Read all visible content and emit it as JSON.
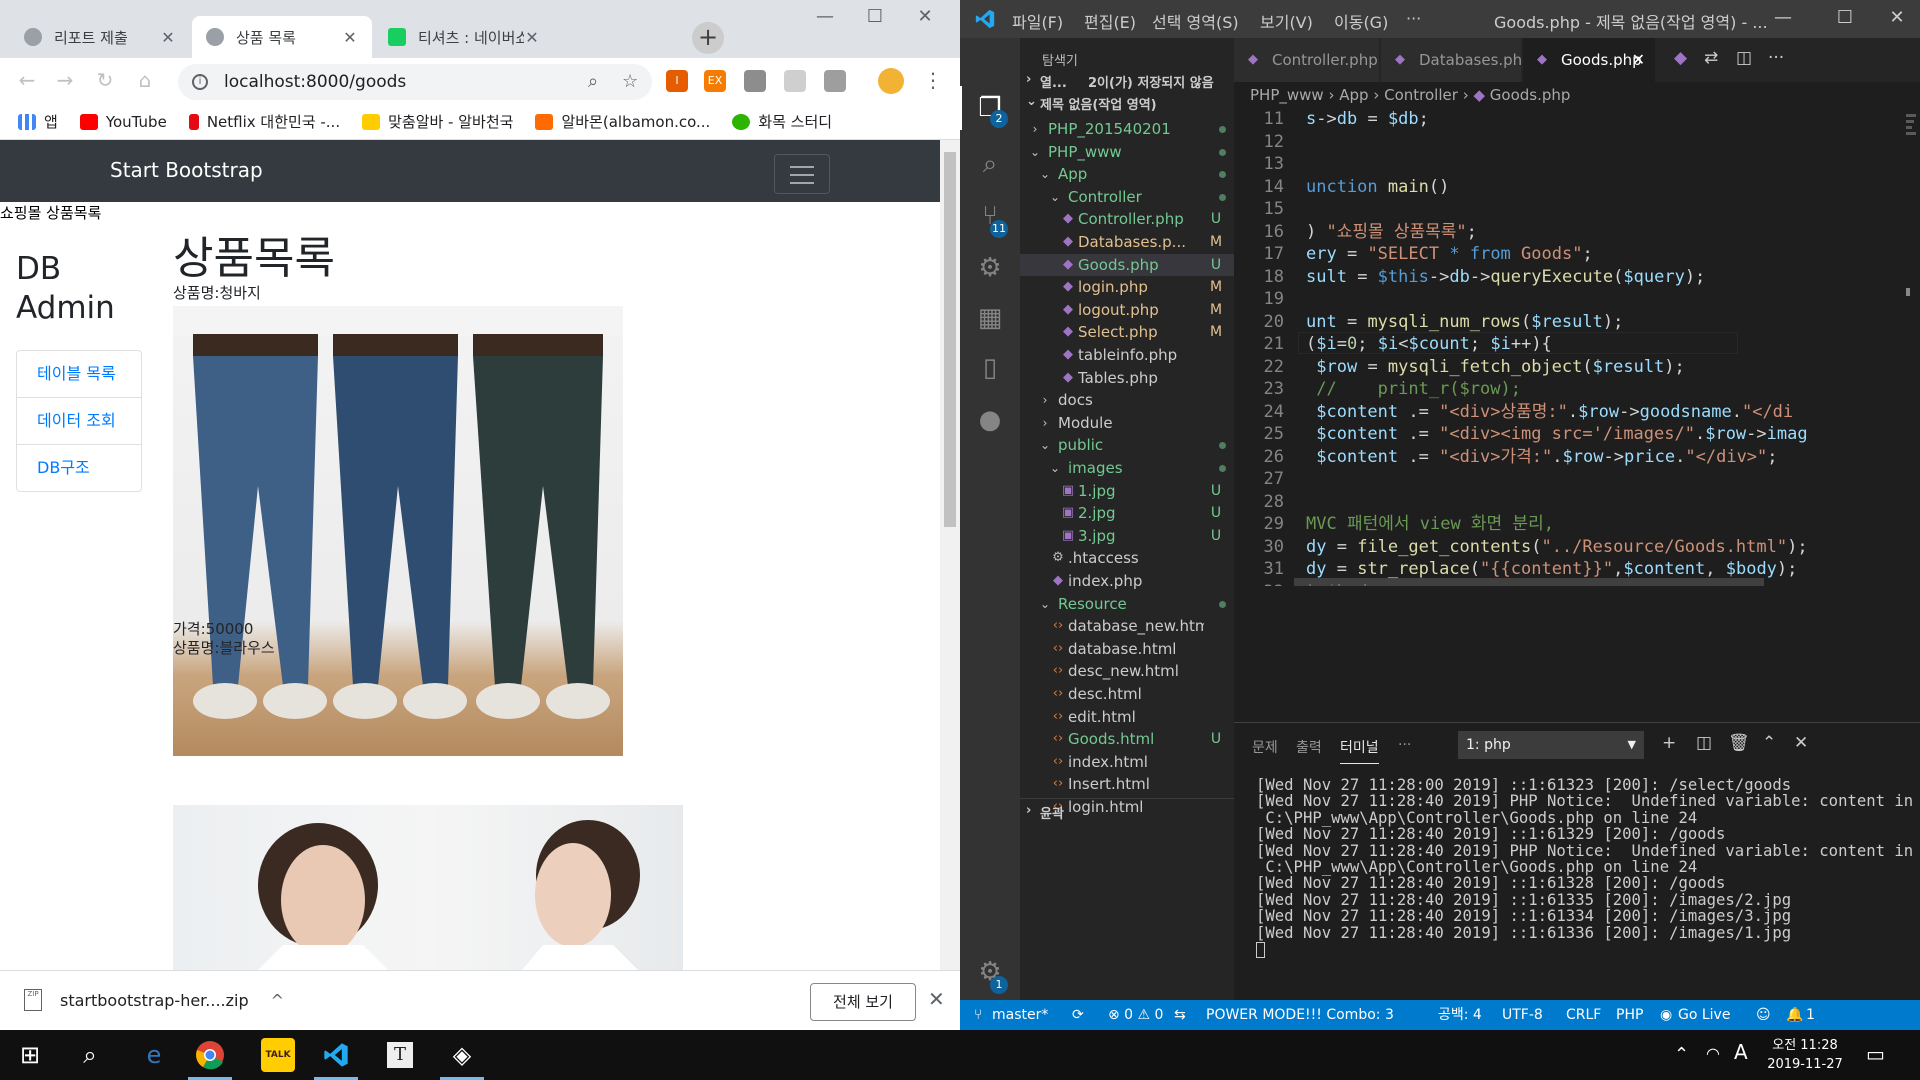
{
  "browser": {
    "tabs": [
      {
        "label": "리포트 제출",
        "active": false
      },
      {
        "label": "상품 목록",
        "active": true
      },
      {
        "label": "티셔츠 : 네이버쇼핑",
        "active": false
      }
    ],
    "new_tab_label": "+",
    "url": "localhost:8000/goods",
    "bookmarks": [
      "앱",
      "YouTube",
      "Netflix 대한민국 -...",
      "맞춤알바 - 알바천국",
      "알바몬(albamon.co...",
      "화목 스터디"
    ],
    "ext_labels": [
      "I",
      "EX"
    ],
    "page": {
      "brand": "Start Bootstrap",
      "doc_title": "쇼핑몰 상품목록",
      "sidebar_title": "DB Admin",
      "sidebar_items": [
        "테이블 목록",
        "데이터 조회",
        "DB구조"
      ],
      "heading": "상품목록",
      "products": [
        {
          "name_line": "상품명:청바지",
          "price_line": "가격:50000"
        },
        {
          "name_line": "상품명:블라우스"
        }
      ]
    },
    "download": {
      "filename": "startbootstrap-her....zip",
      "show_all": "전체 보기"
    }
  },
  "vscode": {
    "menu": [
      "파일(F)",
      "편집(E)",
      "선택 영역(S)",
      "보기(V)",
      "이동(G)",
      "···"
    ],
    "window_title": "Goods.php - 제목 없음(작업 영역) - ...",
    "explorer": {
      "title": "탐색기",
      "open_editors": "열...",
      "unsaved": "2이(가) 저장되지 않음",
      "workspace": "제목 없음(작업 영역)",
      "outline": "윤곽",
      "tree": [
        {
          "name": "PHP_201540201",
          "depth": 0,
          "kind": "folder-closed",
          "status": "dot"
        },
        {
          "name": "PHP_www",
          "depth": 0,
          "kind": "folder-open",
          "status": "dot"
        },
        {
          "name": "App",
          "depth": 1,
          "kind": "folder-open",
          "status": "dot"
        },
        {
          "name": "Controller",
          "depth": 2,
          "kind": "folder-open",
          "status": "dot"
        },
        {
          "name": "Controller.php",
          "depth": 3,
          "kind": "php",
          "status": "U"
        },
        {
          "name": "Databases.p...",
          "depth": 3,
          "kind": "php",
          "status": "M"
        },
        {
          "name": "Goods.php",
          "depth": 3,
          "kind": "php",
          "status": "U",
          "selected": true
        },
        {
          "name": "login.php",
          "depth": 3,
          "kind": "php",
          "status": "M"
        },
        {
          "name": "logout.php",
          "depth": 3,
          "kind": "php",
          "status": "M"
        },
        {
          "name": "Select.php",
          "depth": 3,
          "kind": "php",
          "status": "M"
        },
        {
          "name": "tableinfo.php",
          "depth": 3,
          "kind": "php",
          "status": ""
        },
        {
          "name": "Tables.php",
          "depth": 3,
          "kind": "php",
          "status": ""
        },
        {
          "name": "docs",
          "depth": 1,
          "kind": "folder-closed",
          "status": ""
        },
        {
          "name": "Module",
          "depth": 1,
          "kind": "folder-closed",
          "status": ""
        },
        {
          "name": "public",
          "depth": 1,
          "kind": "folder-open",
          "status": "dot"
        },
        {
          "name": "images",
          "depth": 2,
          "kind": "folder-open",
          "status": "dot"
        },
        {
          "name": "1.jpg",
          "depth": 3,
          "kind": "image",
          "status": "U"
        },
        {
          "name": "2.jpg",
          "depth": 3,
          "kind": "image",
          "status": "U"
        },
        {
          "name": "3.jpg",
          "depth": 3,
          "kind": "image",
          "status": "U"
        },
        {
          "name": ".htaccess",
          "depth": 2,
          "kind": "gear",
          "status": ""
        },
        {
          "name": "index.php",
          "depth": 2,
          "kind": "php",
          "status": ""
        },
        {
          "name": "Resource",
          "depth": 1,
          "kind": "folder-open",
          "status": "dot"
        },
        {
          "name": "database_new.html",
          "depth": 2,
          "kind": "html",
          "status": ""
        },
        {
          "name": "database.html",
          "depth": 2,
          "kind": "html",
          "status": ""
        },
        {
          "name": "desc_new.html",
          "depth": 2,
          "kind": "html",
          "status": ""
        },
        {
          "name": "desc.html",
          "depth": 2,
          "kind": "html",
          "status": ""
        },
        {
          "name": "edit.html",
          "depth": 2,
          "kind": "html",
          "status": ""
        },
        {
          "name": "Goods.html",
          "depth": 2,
          "kind": "html",
          "status": "U"
        },
        {
          "name": "index.html",
          "depth": 2,
          "kind": "html",
          "status": ""
        },
        {
          "name": "Insert.html",
          "depth": 2,
          "kind": "html",
          "status": ""
        },
        {
          "name": "login.html",
          "depth": 2,
          "kind": "html",
          "status": ""
        }
      ]
    },
    "tabs": [
      {
        "label": "Controller.php",
        "active": false
      },
      {
        "label": "Databases.php",
        "active": false
      },
      {
        "label": "Goods.php",
        "active": true
      }
    ],
    "breadcrumb": [
      "PHP_www",
      "App",
      "Controller",
      "Goods.php"
    ],
    "code_lines": [
      {
        "n": "11",
        "html": "<span style='color:#9cdcfe'>s</span>-><span style='color:#9cdcfe'>db</span> = <span style='color:#9cdcfe'>$db</span>;"
      },
      {
        "n": "12",
        "html": ""
      },
      {
        "n": "13",
        "html": ""
      },
      {
        "n": "14",
        "html": "<span style='color:#569cd6'>unction</span> <span style='color:#dcdcaa'>main</span>()"
      },
      {
        "n": "15",
        "html": ""
      },
      {
        "n": "16",
        "html": ") <span style='color:#ce9178'>\"쇼핑몰 상품목록\"</span>;"
      },
      {
        "n": "17",
        "html": "<span style='color:#9cdcfe'>ery</span> = <span style='color:#ce9178'>\"SELECT</span> <span style='color:#569cd6'>*</span> <span style='color:#569cd6'>from</span> <span style='color:#ce9178'>Goods\"</span>;"
      },
      {
        "n": "18",
        "html": "<span style='color:#9cdcfe'>sult</span> = <span style='color:#569cd6'>$this</span>-><span style='color:#9cdcfe'>db</span>-><span style='color:#dcdcaa'>queryExecute</span>(<span style='color:#9cdcfe'>$query</span>);"
      },
      {
        "n": "19",
        "html": ""
      },
      {
        "n": "20",
        "html": "<span style='color:#9cdcfe'>unt</span> = <span style='color:#dcdcaa'>mysqli_num_rows</span>(<span style='color:#9cdcfe'>$result</span>);"
      },
      {
        "n": "21",
        "html": "(<span style='color:#9cdcfe'>$i</span>=<span style='color:#b5cea8'>0</span>; <span style='color:#9cdcfe'>$i</span>&lt;<span style='color:#9cdcfe'>$count</span>; <span style='color:#9cdcfe'>$i</span>++){"
      },
      {
        "n": "22",
        "html": " <span style='color:#9cdcfe'>$row</span> = <span style='color:#dcdcaa'>mysqli_fetch_object</span>(<span style='color:#9cdcfe'>$result</span>);"
      },
      {
        "n": "23",
        "html": " <span style='color:#6a9955'>//    print_r($row);</span>"
      },
      {
        "n": "24",
        "html": " <span style='color:#9cdcfe'>$content</span> .= <span style='color:#ce9178'>\"&lt;div&gt;상품명:\"</span>.<span style='color:#9cdcfe'>$row</span>-><span style='color:#9cdcfe'>goodsname</span>.<span style='color:#ce9178'>\"&lt;/di</span>"
      },
      {
        "n": "25",
        "html": " <span style='color:#9cdcfe'>$content</span> .= <span style='color:#ce9178'>\"&lt;div&gt;&lt;img src='/images/\"</span>.<span style='color:#9cdcfe'>$row</span>-><span style='color:#9cdcfe'>imag</span>"
      },
      {
        "n": "26",
        "html": " <span style='color:#9cdcfe'>$content</span> .= <span style='color:#ce9178'>\"&lt;div&gt;가격:\"</span>.<span style='color:#9cdcfe'>$row</span>-><span style='color:#9cdcfe'>price</span>.<span style='color:#ce9178'>\"&lt;/div&gt;\"</span>;"
      },
      {
        "n": "27",
        "html": ""
      },
      {
        "n": "28",
        "html": ""
      },
      {
        "n": "29",
        "html": "<span style='color:#6a9955'>MVC 패턴에서 view 화면 분리,</span>"
      },
      {
        "n": "30",
        "html": "<span style='color:#9cdcfe'>dy</span> = <span style='color:#dcdcaa'>file_get_contents</span>(<span style='color:#ce9178'>\"../Resource/Goods.html\"</span>);"
      },
      {
        "n": "31",
        "html": "<span style='color:#9cdcfe'>dy</span> = <span style='color:#dcdcaa'>str_replace</span>(<span style='color:#ce9178'>\"{{content}}\"</span>,<span style='color:#9cdcfe'>$content</span>, <span style='color:#9cdcfe'>$body</span>);"
      },
      {
        "n": "32",
        "html": ") <span style='color:#9cdcfe'>$body</span>;"
      }
    ],
    "panel": {
      "tabs": [
        "문제",
        "출력",
        "터미널",
        "···"
      ],
      "active_tab": "터미널",
      "terminal_select": "1: php",
      "terminal_lines": [
        "[Wed Nov 27 11:28:00 2019] ::1:61323 [200]: /select/goods",
        "[Wed Nov 27 11:28:40 2019] PHP Notice:  Undefined variable: content in",
        " C:\\PHP_www\\App\\Controller\\Goods.php on line 24",
        "[Wed Nov 27 11:28:40 2019] ::1:61329 [200]: /goods",
        "[Wed Nov 27 11:28:40 2019] PHP Notice:  Undefined variable: content in",
        " C:\\PHP_www\\App\\Controller\\Goods.php on line 24",
        "[Wed Nov 27 11:28:40 2019] ::1:61328 [200]: /goods",
        "[Wed Nov 27 11:28:40 2019] ::1:61335 [200]: /images/2.jpg",
        "[Wed Nov 27 11:28:40 2019] ::1:61334 [200]: /images/3.jpg",
        "[Wed Nov 27 11:28:40 2019] ::1:61336 [200]: /images/1.jpg"
      ]
    },
    "status": {
      "branch": "master*",
      "errors": "⊗ 0 ⚠ 0",
      "power_mode": "POWER MODE!!! Combo: 3",
      "spaces": "공백: 4",
      "encoding": "UTF-8",
      "eol": "CRLF",
      "language": "PHP",
      "go_live": "Go Live",
      "notifications": "1"
    },
    "badges": {
      "explorer": "2",
      "scm": "11",
      "settings": "1"
    }
  },
  "taskbar": {
    "ime": "A",
    "time": "오전 11:28",
    "date": "2019-11-27",
    "talk_label": "TALK"
  }
}
